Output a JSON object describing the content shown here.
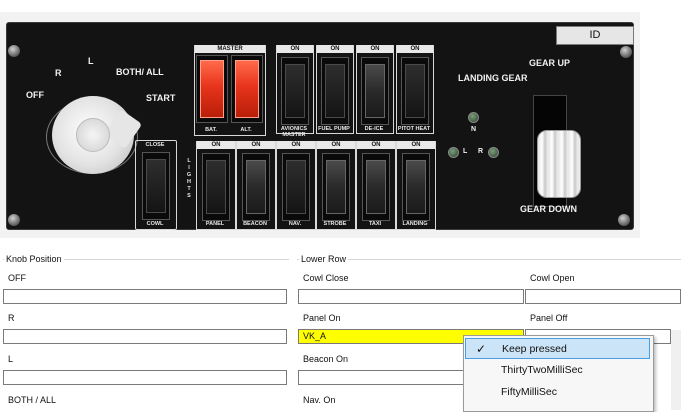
{
  "panel": {
    "id_button": "ID",
    "knob": {
      "off": "OFF",
      "r": "R",
      "l": "L",
      "both": "BOTH/ ALL",
      "start": "START"
    },
    "master_label": "MASTER",
    "bat": "BAT.",
    "alt": "ALT.",
    "on": "ON",
    "upper_switches": [
      "AVIONICS MASTER",
      "FUEL PUMP",
      "DE-ICE",
      "PITOT HEAT"
    ],
    "cowl_close": "CLOSE",
    "cowl": "COWL",
    "lights_vertical": "LIGHTS",
    "lower_switches": [
      "PANEL",
      "BEACON",
      "NAV.",
      "STROBE",
      "TAXI",
      "LANDING"
    ],
    "landing_gear": "LANDING GEAR",
    "gear_n": "N",
    "gear_l": "L",
    "gear_r": "R",
    "gear_up": "GEAR UP",
    "gear_down": "GEAR DOWN"
  },
  "knob_position": {
    "group_title": "Knob Position",
    "items": [
      {
        "label": "OFF",
        "value": ""
      },
      {
        "label": "R",
        "value": ""
      },
      {
        "label": "L",
        "value": ""
      },
      {
        "label": "BOTH / ALL"
      }
    ]
  },
  "lower_row": {
    "group_title": "Lower Row",
    "cowl_close": {
      "label": "Cowl Close",
      "value": ""
    },
    "cowl_open": {
      "label": "Cowl Open",
      "value": ""
    },
    "panel_on": {
      "label": "Panel On",
      "value": "VK_A"
    },
    "panel_off": {
      "label": "Panel Off"
    },
    "beacon_on": {
      "label": "Beacon On",
      "value": ""
    },
    "nav_on": {
      "label": "Nav. On"
    }
  },
  "dropdown": {
    "options": [
      "Keep pressed",
      "ThirtyTwoMilliSec",
      "FiftyMilliSec"
    ],
    "selected_index": 0,
    "check_glyph": "✓"
  },
  "colors": {
    "highlight_field": "#ffff00",
    "selected_option": "#cce4f7"
  }
}
